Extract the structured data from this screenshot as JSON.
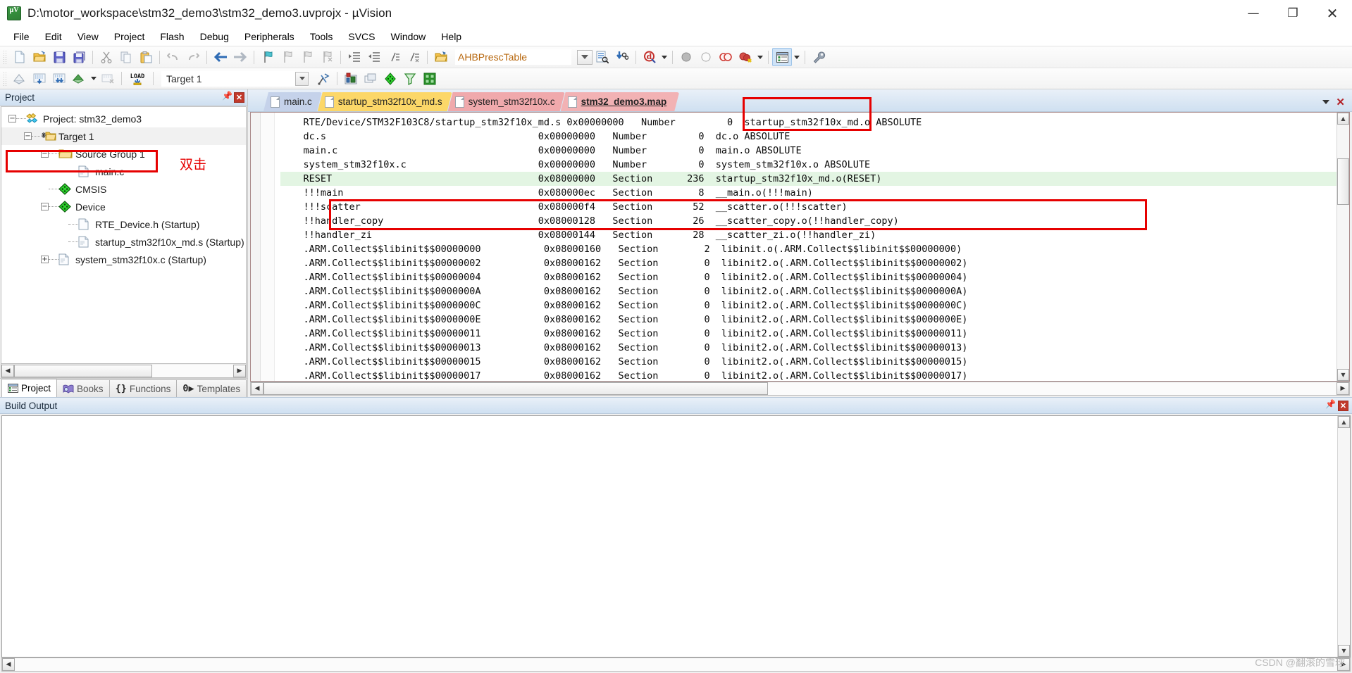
{
  "window": {
    "title": "D:\\motor_workspace\\stm32_demo3\\stm32_demo3.uvprojx - µVision",
    "minimize": "—",
    "maximize": "❐",
    "close": "✕"
  },
  "menu": {
    "items": [
      "File",
      "Edit",
      "View",
      "Project",
      "Flash",
      "Debug",
      "Peripherals",
      "Tools",
      "SVCS",
      "Window",
      "Help"
    ]
  },
  "toolbar": {
    "symbol_combo_value": "AHBPrescTable",
    "target_combo_value": "Target 1",
    "load_label": "LOAD"
  },
  "project_panel": {
    "header": "Project",
    "tree": [
      {
        "label": "Project: stm32_demo3",
        "indent": 0,
        "expander": "-",
        "icon": "project-icon"
      },
      {
        "label": "Target 1",
        "indent": 1,
        "expander": "-",
        "icon": "target-folder-icon"
      },
      {
        "label": "Source Group 1",
        "indent": 2,
        "expander": "-",
        "icon": "folder-icon"
      },
      {
        "label": "main.c",
        "indent": 3,
        "expander": "",
        "icon": "c-file-icon"
      },
      {
        "label": "CMSIS",
        "indent": 2,
        "expander": "",
        "icon": "green-diamond-icon"
      },
      {
        "label": "Device",
        "indent": 2,
        "expander": "-",
        "icon": "green-diamond-icon"
      },
      {
        "label": "RTE_Device.h (Startup)",
        "indent": 3,
        "expander": "",
        "icon": "h-file-icon"
      },
      {
        "label": "startup_stm32f10x_md.s (Startup)",
        "indent": 3,
        "expander": "",
        "icon": "s-file-icon"
      },
      {
        "label": "system_stm32f10x.c (Startup)",
        "indent": 3,
        "expander": "+",
        "icon": "c-file-icon"
      }
    ],
    "tabs": [
      {
        "label": "Project",
        "icon": "project-tab-icon",
        "active": true
      },
      {
        "label": "Books",
        "icon": "books-icon",
        "active": false
      },
      {
        "label": "Functions",
        "icon": "functions-icon",
        "active": false
      },
      {
        "label": "Templates",
        "icon": "templates-icon",
        "active": false
      }
    ]
  },
  "editor": {
    "tabs": [
      {
        "label": "main.c",
        "color": "blue",
        "active": false
      },
      {
        "label": "startup_stm32f10x_md.s",
        "color": "yellow",
        "active": false
      },
      {
        "label": "system_stm32f10x.c",
        "color": "pink",
        "active": false
      },
      {
        "label": "stm32_demo3.map",
        "color": "pink",
        "active": true
      }
    ],
    "lines": [
      {
        "text": "    RTE/Device/STM32F103C8/startup_stm32f10x_md.s 0x00000000   Number         0  startup_stm32f10x_md.o ABSOLUTE",
        "highlight": false
      },
      {
        "text": "    dc.s                                     0x00000000   Number         0  dc.o ABSOLUTE",
        "highlight": false
      },
      {
        "text": "    main.c                                   0x00000000   Number         0  main.o ABSOLUTE",
        "highlight": false
      },
      {
        "text": "    system_stm32f10x.c                       0x00000000   Number         0  system_stm32f10x.o ABSOLUTE",
        "highlight": false
      },
      {
        "text": "    RESET                                    0x08000000   Section      236  startup_stm32f10x_md.o(RESET)",
        "highlight": true
      },
      {
        "text": "    !!!main                                  0x080000ec   Section        8  __main.o(!!!main)",
        "highlight": false
      },
      {
        "text": "    !!!scatter                               0x080000f4   Section       52  __scatter.o(!!!scatter)",
        "highlight": false
      },
      {
        "text": "    !!handler_copy                           0x08000128   Section       26  __scatter_copy.o(!!handler_copy)",
        "highlight": false
      },
      {
        "text": "    !!handler_zi                             0x08000144   Section       28  __scatter_zi.o(!!handler_zi)",
        "highlight": false
      },
      {
        "text": "    .ARM.Collect$$libinit$$00000000           0x08000160   Section        2  libinit.o(.ARM.Collect$$libinit$$00000000)",
        "highlight": false
      },
      {
        "text": "    .ARM.Collect$$libinit$$00000002           0x08000162   Section        0  libinit2.o(.ARM.Collect$$libinit$$00000002)",
        "highlight": false
      },
      {
        "text": "    .ARM.Collect$$libinit$$00000004           0x08000162   Section        0  libinit2.o(.ARM.Collect$$libinit$$00000004)",
        "highlight": false
      },
      {
        "text": "    .ARM.Collect$$libinit$$0000000A           0x08000162   Section        0  libinit2.o(.ARM.Collect$$libinit$$0000000A)",
        "highlight": false
      },
      {
        "text": "    .ARM.Collect$$libinit$$0000000C           0x08000162   Section        0  libinit2.o(.ARM.Collect$$libinit$$0000000C)",
        "highlight": false
      },
      {
        "text": "    .ARM.Collect$$libinit$$0000000E           0x08000162   Section        0  libinit2.o(.ARM.Collect$$libinit$$0000000E)",
        "highlight": false
      },
      {
        "text": "    .ARM.Collect$$libinit$$00000011           0x08000162   Section        0  libinit2.o(.ARM.Collect$$libinit$$00000011)",
        "highlight": false
      },
      {
        "text": "    .ARM.Collect$$libinit$$00000013           0x08000162   Section        0  libinit2.o(.ARM.Collect$$libinit$$00000013)",
        "highlight": false
      },
      {
        "text": "    .ARM.Collect$$libinit$$00000015           0x08000162   Section        0  libinit2.o(.ARM.Collect$$libinit$$00000015)",
        "highlight": false
      },
      {
        "text": "    .ARM.Collect$$libinit$$00000017           0x08000162   Section        0  libinit2.o(.ARM.Collect$$libinit$$00000017)",
        "highlight": false
      }
    ]
  },
  "build_output": {
    "header": "Build Output",
    "content": ""
  },
  "annotations": {
    "double_click_note": "双击"
  },
  "watermark": "CSDN @翻滚的雪球",
  "colors": {
    "annotation_red": "#e60000",
    "highlight_green": "#e3f5e3",
    "panel_blue": "#cfe0f1",
    "tab_pink": "#f0a9ac",
    "tab_yellow": "#fcd768",
    "tab_blue": "#c5d2ea"
  }
}
